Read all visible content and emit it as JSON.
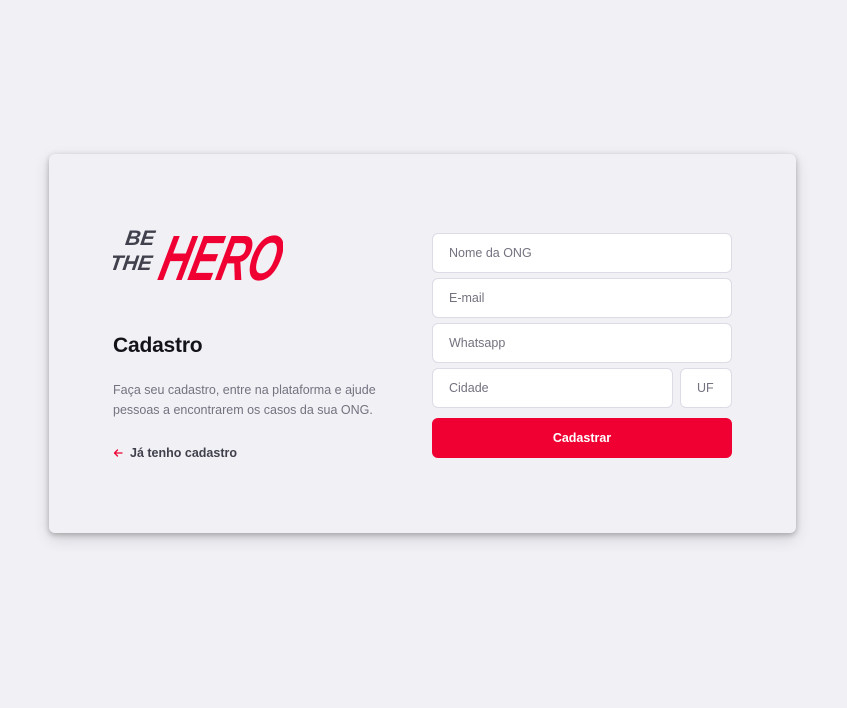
{
  "brand": {
    "logo_text_small_1": "BE",
    "logo_text_small_2": "THE",
    "logo_text_large": "HERO",
    "logo_dark_color": "#41414d",
    "logo_red_color": "#f00032"
  },
  "register": {
    "title": "Cadastro",
    "description": "Faça seu cadastro, entre na plataforma e ajude pessoas a encontrarem os casos da sua ONG.",
    "back_link_label": "Já tenho cadastro"
  },
  "form": {
    "name_placeholder": "Nome da ONG",
    "email_placeholder": "E-mail",
    "whatsapp_placeholder": "Whatsapp",
    "city_placeholder": "Cidade",
    "uf_placeholder": "UF",
    "submit_label": "Cadastrar"
  },
  "colors": {
    "background": "#f0f0f5",
    "accent": "#f00032",
    "text_dark": "#13131a",
    "text_muted": "#737380"
  }
}
